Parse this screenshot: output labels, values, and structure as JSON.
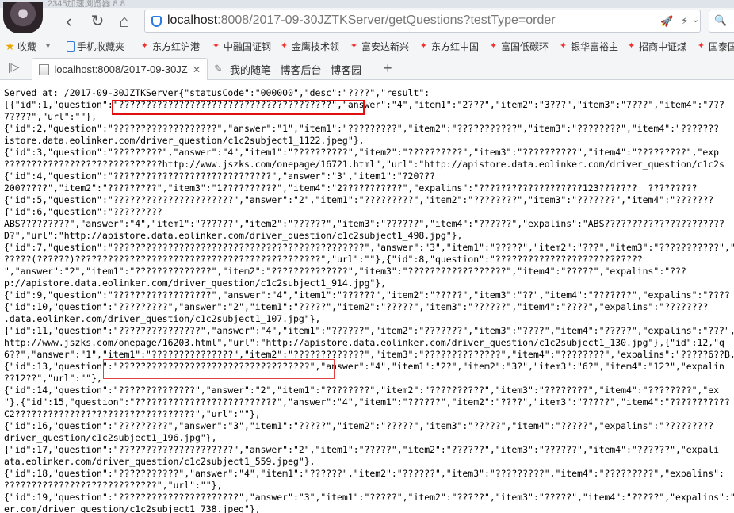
{
  "window": {
    "title": "2345加速浏览器 8.8"
  },
  "toolbar": {
    "back_icon": "‹",
    "forward_icon": "›",
    "reload_icon": "↻",
    "home_icon": "⌂",
    "address_host": "localhost",
    "address_rest": ":8008/2017-09-30JZTKServer/getQuestions?testType=order",
    "rocket_icon": "🚀",
    "bolt_icon": "⚡",
    "chevron_icon": "⌄",
    "search_icon": "🔍"
  },
  "bookmarks": [
    {
      "label": "收藏",
      "icon": "star-icon",
      "glyph": "★",
      "dropdown": "▾"
    },
    {
      "label": "手机收藏夹",
      "icon": "phone-icon",
      "glyph": ""
    },
    {
      "label": "东方红沪港",
      "icon": "bookmark-fire-icon",
      "glyph": "✦"
    },
    {
      "label": "中融国证钢",
      "icon": "bookmark-fire-icon",
      "glyph": "✦"
    },
    {
      "label": "金鹰技术领",
      "icon": "bookmark-fire-icon",
      "glyph": "✦"
    },
    {
      "label": "富安达新兴",
      "icon": "bookmark-fire-icon",
      "glyph": "✦"
    },
    {
      "label": "东方红中国",
      "icon": "bookmark-fire-icon",
      "glyph": "✦"
    },
    {
      "label": "富国低碳环",
      "icon": "bookmark-fire-icon",
      "glyph": "✦"
    },
    {
      "label": "银华富裕主",
      "icon": "bookmark-fire-icon",
      "glyph": "✦"
    },
    {
      "label": "招商中证煤",
      "icon": "bookmark-fire-icon",
      "glyph": "✦"
    },
    {
      "label": "国泰国",
      "icon": "bookmark-fire-icon",
      "glyph": "✦"
    }
  ],
  "tabs": {
    "toggle_icon": "|▷",
    "items": [
      {
        "label": "localhost:8008/2017-09-30JZ",
        "close": "✕",
        "active": true
      },
      {
        "label": "我的随笔 - 博客后台 - 博客园",
        "close": "",
        "active": false
      }
    ],
    "new_tab_icon": "+"
  },
  "page": {
    "lines": [
      "Served at: /2017-09-30JZTKServer{\"statusCode\":\"000000\",\"desc\":\"????\",\"result\":",
      "[{\"id\":1,\"question\":\"???????????????????????????????????????\",\"answer\":\"4\",\"item1\":\"2???\",\"item2\":\"3???\",\"item3\":\"7???\",\"item4\":\"7??",
      "7????\",\"url\":\"\"},",
      "{\"id\":2,\"question\":\"???????????????????\",\"answer\":\"1\",\"item1\":\"?????????\",\"item2\":\"???????????\",\"item3\":\"????????\",\"item4\":\"???????",
      "istore.data.eolinker.com/driver_question/c1c2subject1_1122.jpeg\"},",
      "{\"id\":3,\"question\":\"?????????\",\"answer\":\"4\",\"item1\":\"??????????\",\"item2\":\"??????????\",\"item3\":\"??????????\",\"item4\":\"?????????\",\"exp",
      "?????????????????????????????http://www.jszks.com/onepage/16721.html\",\"url\":\"http://apistore.data.eolinker.com/driver_question/c1c2s",
      "{\"id\":4,\"question\":\"?????????????????????????????\",\"answer\":\"3\",\"item1\":\"?20???",
      "200?????\",\"item2\":\"?????????\",\"item3\":\"1??????????\",\"item4\":\"2???????????\",\"expalins\":\"???????????????????123???????  ?????????",
      "{\"id\":5,\"question\":\"??????????????????????\",\"answer\":\"2\",\"item1\":\"?????????\",\"item2\":\"????????\",\"item3\":\"???????\",\"item4\":\"???????",
      "{\"id\":6,\"question\":\"?????????",
      "ABS?????????\",\"answer\":\"4\",\"item1\":\"??????\",\"item2\":\"??????\",\"item3\":\"??????\",\"item4\":\"??????\",\"expalins\":\"ABS??????????????????????",
      "D?\",\"url\":\"http://apistore.data.eolinker.com/driver_question/c1c2subject1_498.jpg\"},",
      "{\"id\":7,\"question\":\"??????????????????????????????????????????????\",\"answer\":\"3\",\"item1\":\"?????\",\"item2\":\"???\",\"item3\":\"???????????\",\"",
      "?????(??????)?????????????????????????????????????????????\",\"url\":\"\"},{\"id\":8,\"question\":\"???????????????????????????",
      "\",\"answer\":\"2\",\"item1\":\"??????????????\",\"item2\":\"??????????????\",\"item3\":\"??????????????????\",\"item4\":\"?????\",\"expalins\":\"???",
      "p://apistore.data.eolinker.com/driver_question/c1c2subject1_914.jpg\"},",
      "{\"id\":9,\"question\":\"??????????????????\",\"answer\":\"4\",\"item1\":\"??????\",\"item2\":\"?????\",\"item3\":\"??\",\"item4\":\"???????\",\"expalins\":\"????",
      "{\"id\":10,\"question\":\"?????????\",\"answer\":\"2\",\"item1\":\"?????\",\"item2\":\"?????\",\"item3\":\"??????\",\"item4\":\"????\",\"expalins\":\"????????",
      ".data.eolinker.com/driver_question/c1c2subject1_107.jpg\"},",
      "{\"id\":11,\"question\":\"???????????????\",\"answer\":\"4\",\"item1\":\"??????\",\"item2\":\"???????\",\"item3\":\"????\",\"item4\":\"?????\",\"expalins\":\"???\",\"id\":12",
      "http://www.jszks.com/onepage/16203.html\",\"url\":\"http://apistore.data.eolinker.com/driver_question/c1c2subject1_130.jpg\"},{\"id\":12,\"q",
      "6??\",\"answer\":\"1\",\"item1\":\"???????????????\",\"item2\":\"?????????????\",\"item3\":\"??????????????\",\"item4\":\"????????\",\"expalins\":\"?????6??B,",
      "{\"id\":13,\"question\":\"???????????????????????????????????\",\"answer\":\"4\",\"item1\":\"2?\",\"item2\":\"3?\",\"item3\":\"6?\",\"item4\":\"12?\",\"expalin",
      "??12??\",\"url\":\"\"},",
      "{\"id\":14,\"question\":\"??????????????\",\"answer\":\"2\",\"item1\":\"????????\",\"item2\":\"??????????\",\"item3\":\"????????\",\"item4\":\"????????\",\"ex",
      "\"},{\"id\":15,\"question\":\"??????????????????????????\",\"answer\":\"4\",\"item1\":\"??????\",\"item2\":\"????\",\"item3\":\"?????\",\"item4\":\"???????????",
      "C2?????????????????????????????????\",\"url\":\"\"},",
      "{\"id\":16,\"question\":\"?????????\",\"answer\":\"3\",\"item1\":\"?????\",\"item2\":\"?????\",\"item3\":\"?????\",\"item4\":\"?????\",\"expalins\":\"?????????",
      "driver_question/c1c2subject1_196.jpg\"},",
      "{\"id\":17,\"question\":\"?????????????????????\",\"answer\":\"2\",\"item1\":\"?????\",\"item2\":\"??????\",\"item3\":\"??????\",\"item4\":\"??????\",\"expali",
      "ata.eolinker.com/driver_question/c1c2subject1_559.jpeg\"},",
      "{\"id\":18,\"question\":\"???????????\",\"answer\":\"4\",\"item1\":\"??????\",\"item2\":\"??????\",\"item3\":\"?????????\",\"item4\":\"?????????\",\"expalins\":",
      "????????????????????????????\",\"url\":\"\"},",
      "{\"id\":19,\"question\":\"??????????????????????\",\"answer\":\"3\",\"item1\":\"?????\",\"item2\":\"?????\",\"item3\":\"?????\",\"item4\":\"?????\",\"expalins\":\"????",
      "er.com/driver_question/c1c2subject1_738.jpeg\"},"
    ]
  }
}
